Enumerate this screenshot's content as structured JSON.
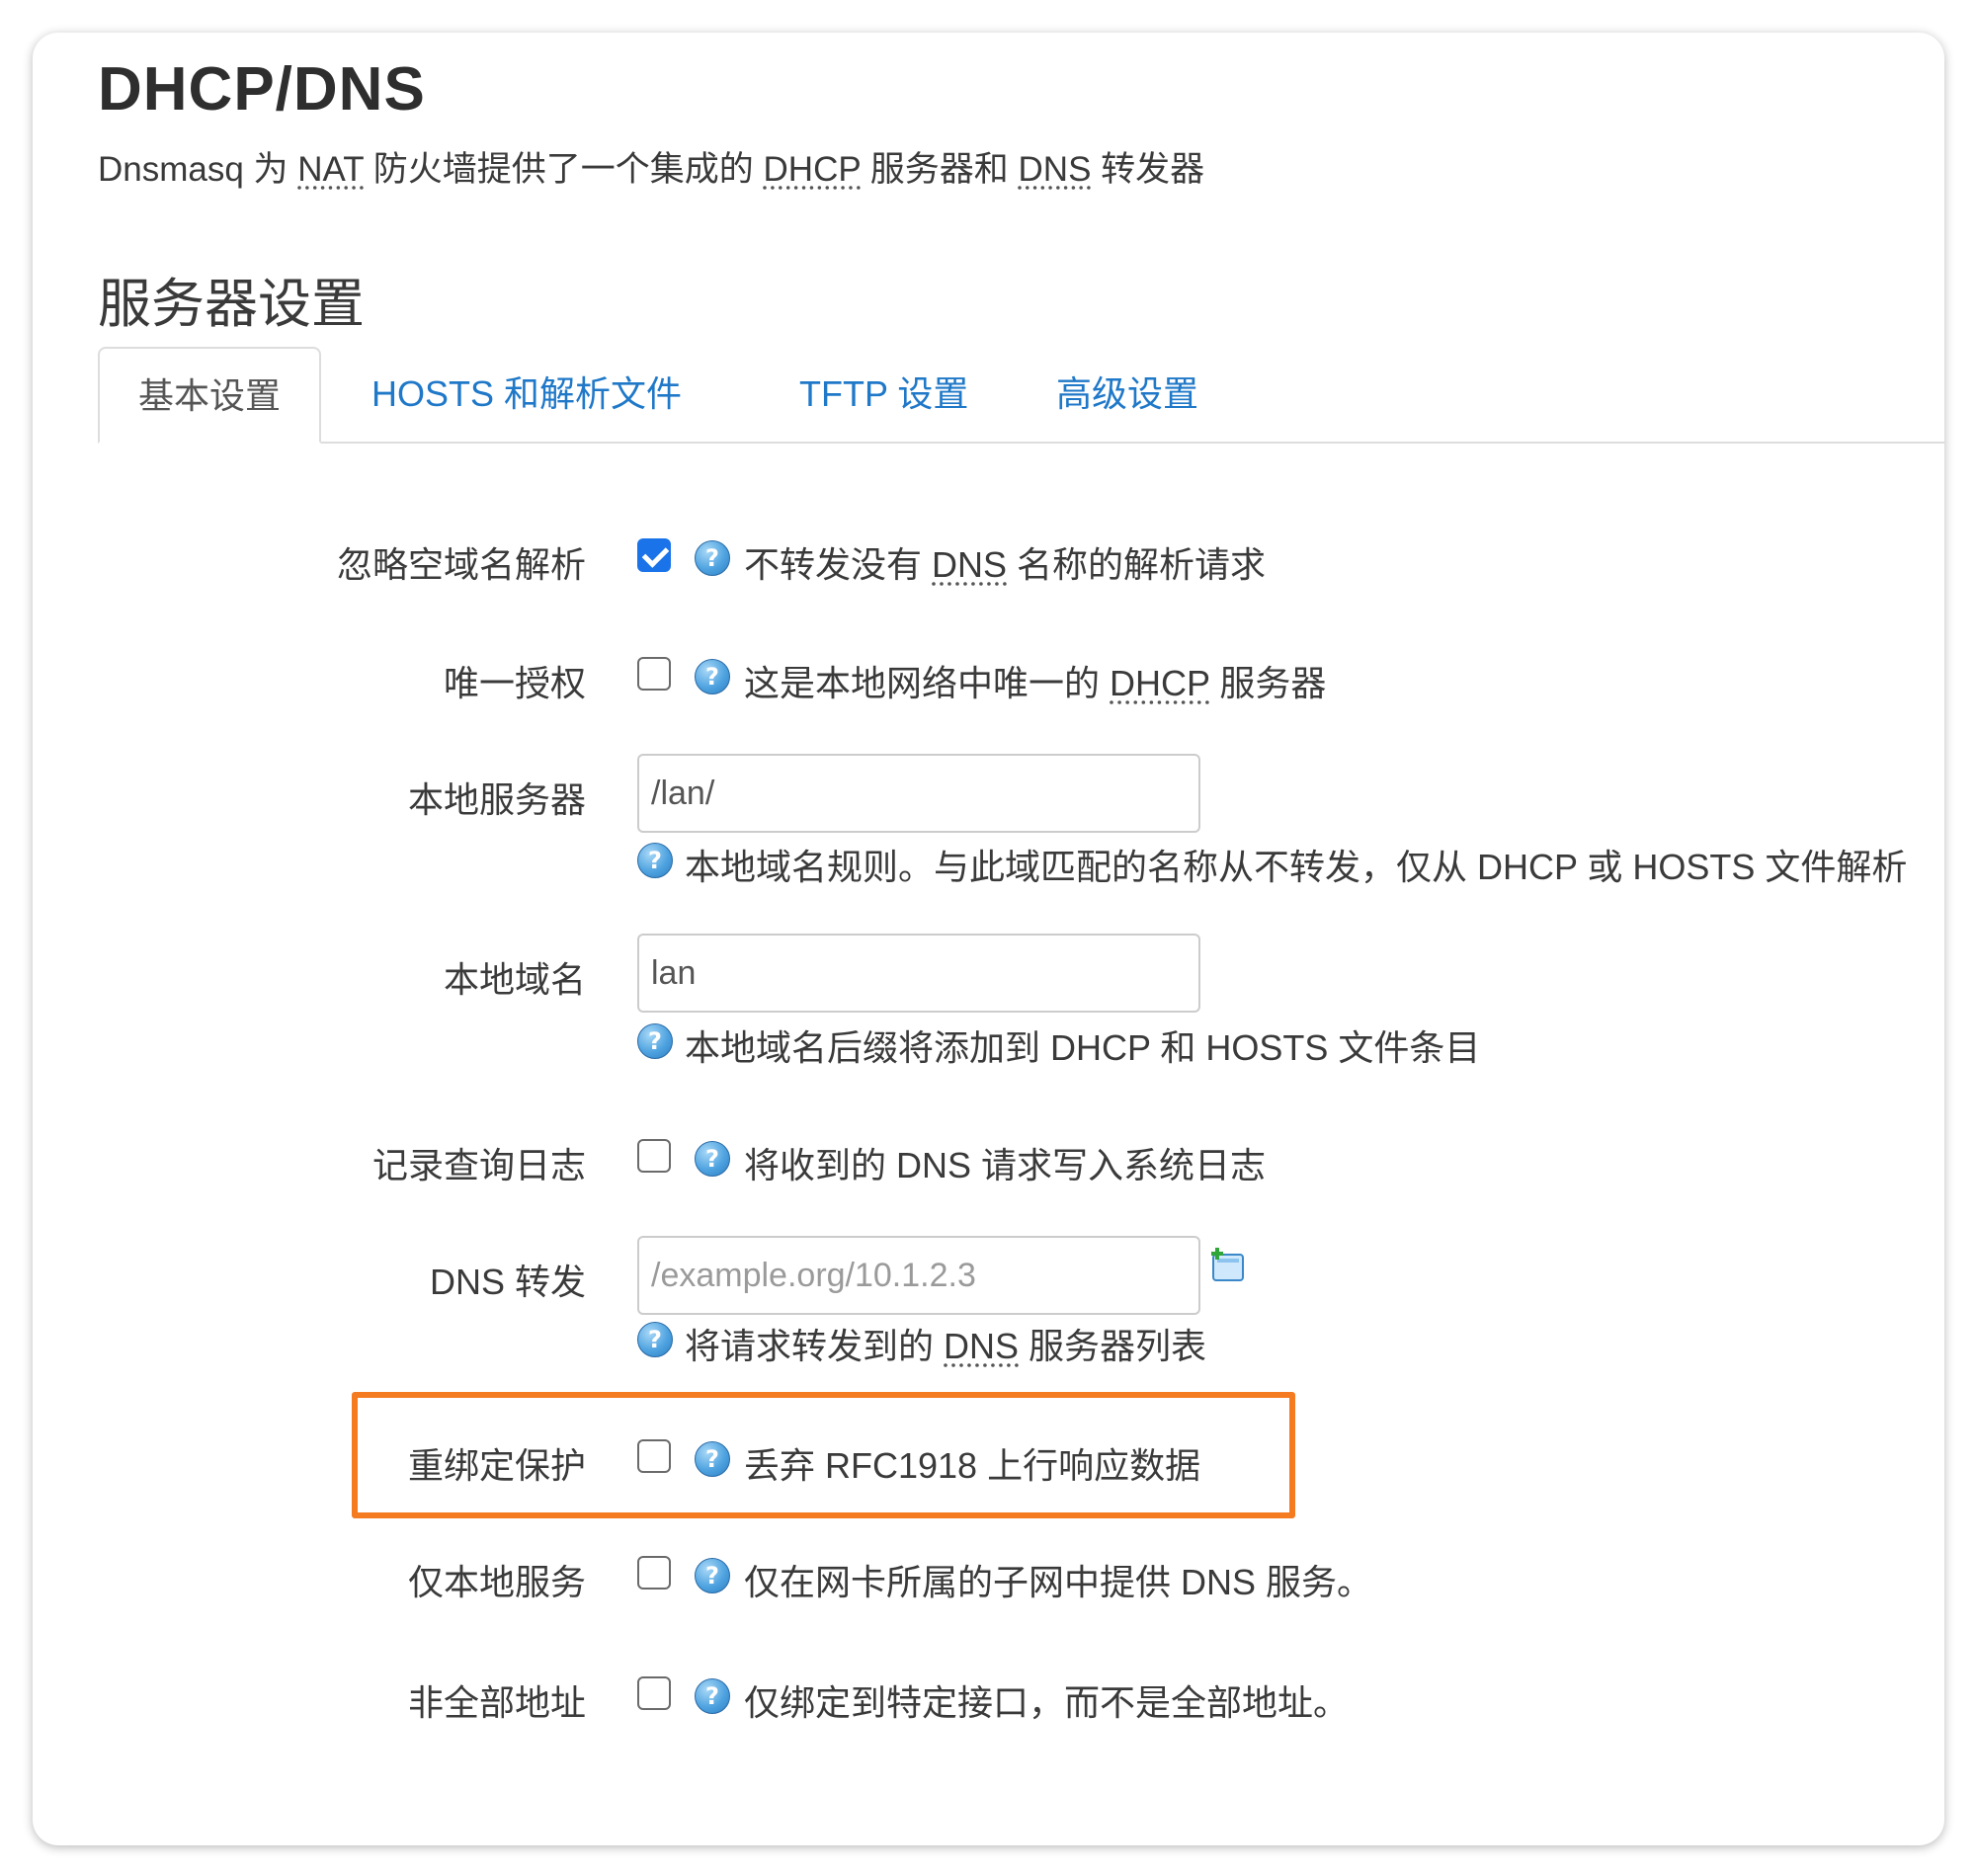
{
  "header": {
    "title": "DHCP/DNS",
    "desc_parts": [
      "Dnsmasq 为 ",
      "NAT",
      " 防火墙提供了一个集成的 ",
      "DHCP",
      " 服务器和 ",
      "DNS",
      " 转发器"
    ]
  },
  "section": {
    "title": "服务器设置"
  },
  "tabs": [
    {
      "label": "基本设置",
      "active": true
    },
    {
      "label": "HOSTS 和解析文件"
    },
    {
      "label": "TFTP 设置"
    },
    {
      "label": "高级设置"
    }
  ],
  "rows": {
    "domainneeded": {
      "label": "忽略空域名解析",
      "checked": true,
      "help_parts": [
        "不转发没有 ",
        "DNS",
        " 名称的解析请求"
      ]
    },
    "authoritative": {
      "label": "唯一授权",
      "checked": false,
      "help_parts": [
        "这是本地网络中唯一的 ",
        "DHCP",
        " 服务器"
      ]
    },
    "local": {
      "label": "本地服务器",
      "value": "/lan/",
      "help": "本地域名规则。与此域匹配的名称从不转发，仅从 DHCP 或 HOSTS 文件解析"
    },
    "domain": {
      "label": "本地域名",
      "value": "lan",
      "help": "本地域名后缀将添加到 DHCP 和 HOSTS 文件条目"
    },
    "logqueries": {
      "label": "记录查询日志",
      "checked": false,
      "help": "将收到的 DNS 请求写入系统日志"
    },
    "server": {
      "label": "DNS 转发",
      "placeholder": "/example.org/10.1.2.3",
      "help_parts": [
        "将请求转发到的 ",
        "DNS",
        " 服务器列表"
      ]
    },
    "rebind_protection": {
      "label": "重绑定保护",
      "checked": false,
      "help": "丢弃 RFC1918 上行响应数据"
    },
    "localservice": {
      "label": "仅本地服务",
      "checked": false,
      "help": "仅在网卡所属的子网中提供 DNS 服务。"
    },
    "nonwildcard": {
      "label": "非全部地址",
      "checked": false,
      "help": "仅绑定到特定接口，而不是全部地址。"
    }
  },
  "icons": {
    "help": "help-question-icon",
    "add": "add-entry-icon"
  },
  "colors": {
    "accent": "#1a73e8",
    "link": "#1f78c8",
    "highlight": "#f47b20"
  }
}
